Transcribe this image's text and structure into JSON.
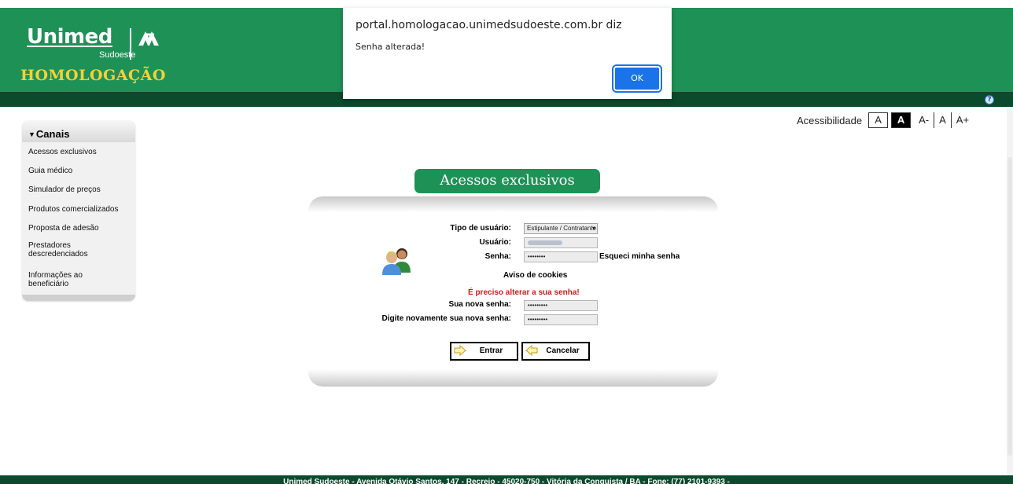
{
  "header": {
    "logo_text": "Unimed",
    "logo_subtext": "Sudoeste",
    "environment_label": "HOMOLOGAÇÃO"
  },
  "dialog": {
    "title": "portal.homologacao.unimedsudoeste.com.br diz",
    "message": "Senha alterada!",
    "ok_label": "OK"
  },
  "accessibility": {
    "label": "Acessibilidade",
    "contrast_light": "A",
    "contrast_dark": "A",
    "font_decrease": "A-",
    "font_reset": "A",
    "font_increase": "A+"
  },
  "sidebar": {
    "title": "Canais",
    "items": [
      {
        "label": "Acessos exclusivos"
      },
      {
        "label": "Guia médico"
      },
      {
        "label": "Simulador de preços"
      },
      {
        "label": "Produtos comercializados"
      },
      {
        "label": "Proposta de adesão"
      },
      {
        "label": "Prestadores descredenciados"
      },
      {
        "label": "Informações ao beneficiário"
      }
    ]
  },
  "login": {
    "title": "Acessos exclusivos",
    "user_type_label": "Tipo de usuário:",
    "user_type_value": "Estipulante / Contratante",
    "user_label": "Usuário:",
    "password_label": "Senha:",
    "password_value": "••••••••",
    "forgot_link": "Esqueci minha senha",
    "cookies_link": "Aviso de cookies",
    "change_warning": "É preciso alterar a sua senha!",
    "new_password_label": "Sua nova senha:",
    "new_password_value": "•••••••••",
    "confirm_password_label": "Digite novamente sua nova senha:",
    "confirm_password_value": "•••••••••",
    "submit_label": "Entrar",
    "cancel_label": "Cancelar"
  },
  "footer": {
    "text": "Unimed Sudoeste - Avenida Otávio Santos, 147 - Recreio - 45020-750 - Vitória da Conquista / BA - Fone: (77) 2101-9393 -"
  },
  "colors": {
    "brand_green": "#1e9157",
    "dark_green": "#0b4a2c",
    "brand_yellow": "#f4d13b",
    "dialog_button": "#1a73e8",
    "warning_red": "#d11b1b"
  }
}
